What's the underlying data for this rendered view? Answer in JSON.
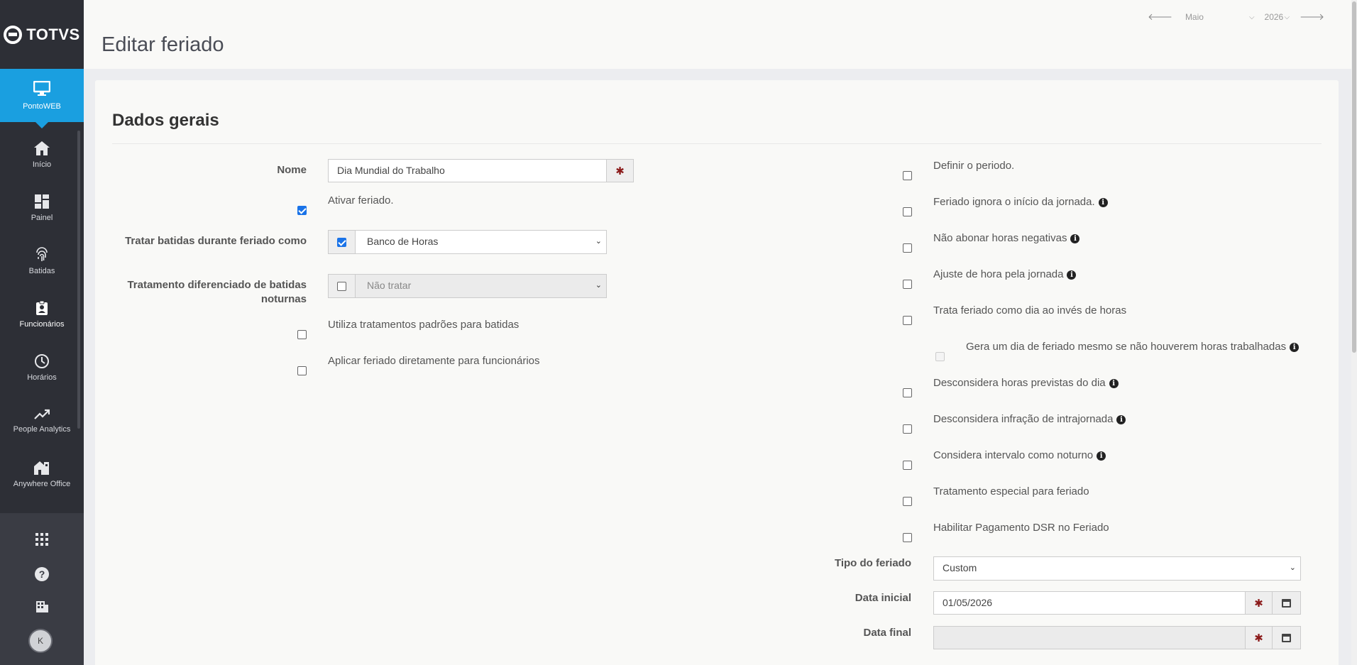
{
  "brand": {
    "name": "TOTVS"
  },
  "sidebar": {
    "active": {
      "label": "PontoWEB",
      "icon": "monitor-icon"
    },
    "items": [
      {
        "label": "Início",
        "icon": "home-icon"
      },
      {
        "label": "Painel",
        "icon": "dashboard-icon"
      },
      {
        "label": "Batidas",
        "icon": "fingerprint-icon"
      },
      {
        "label": "Funcionários",
        "icon": "clipboard-user-icon"
      },
      {
        "label": "Horários",
        "icon": "clock-icon"
      },
      {
        "label": "People Analytics",
        "icon": "trend-icon"
      },
      {
        "label": "Anywhere Office",
        "icon": "home-office-icon"
      }
    ],
    "avatar_initial": "K"
  },
  "header": {
    "title": "Editar feriado",
    "month": "Maio",
    "year": "2026"
  },
  "form": {
    "section_title": "Dados gerais",
    "nome_label": "Nome",
    "nome_value": "Dia Mundial do Trabalho",
    "ativar_label": "Ativar feriado.",
    "ativar_checked": true,
    "tratar_label": "Tratar batidas durante feriado como",
    "tratar_value": "Banco de Horas",
    "tratar_checked": true,
    "noturnas_label": "Tratamento diferenciado de batidas noturnas",
    "noturnas_value": "Não tratar",
    "noturnas_checked": false,
    "padroes_label": "Utiliza tratamentos padrões para batidas",
    "aplicar_label": "Aplicar feriado diretamente para funcionários",
    "right_options": [
      {
        "label": "Definir o periodo.",
        "info": false
      },
      {
        "label": "Feriado ignora o início da jornada.",
        "info": true
      },
      {
        "label": "Não abonar horas negativas",
        "info": true
      },
      {
        "label": "Ajuste de hora pela jornada",
        "info": true
      },
      {
        "label": "Trata feriado como dia ao invés de horas",
        "info": false
      },
      {
        "label": "Gera um dia de feriado mesmo se não houverem horas trabalhadas",
        "info": true,
        "disabled": true
      },
      {
        "label": "Desconsidera horas previstas do dia",
        "info": true
      },
      {
        "label": "Desconsidera infração de intrajornada",
        "info": true
      },
      {
        "label": "Considera intervalo como noturno",
        "info": true
      },
      {
        "label": "Tratamento especial para feriado",
        "info": false
      },
      {
        "label": "Habilitar Pagamento DSR no Feriado",
        "info": false
      }
    ],
    "tipo_label": "Tipo do feriado",
    "tipo_value": "Custom",
    "data_inicial_label": "Data inicial",
    "data_inicial_value": "01/05/2026",
    "data_final_label": "Data final",
    "data_final_value": ""
  }
}
